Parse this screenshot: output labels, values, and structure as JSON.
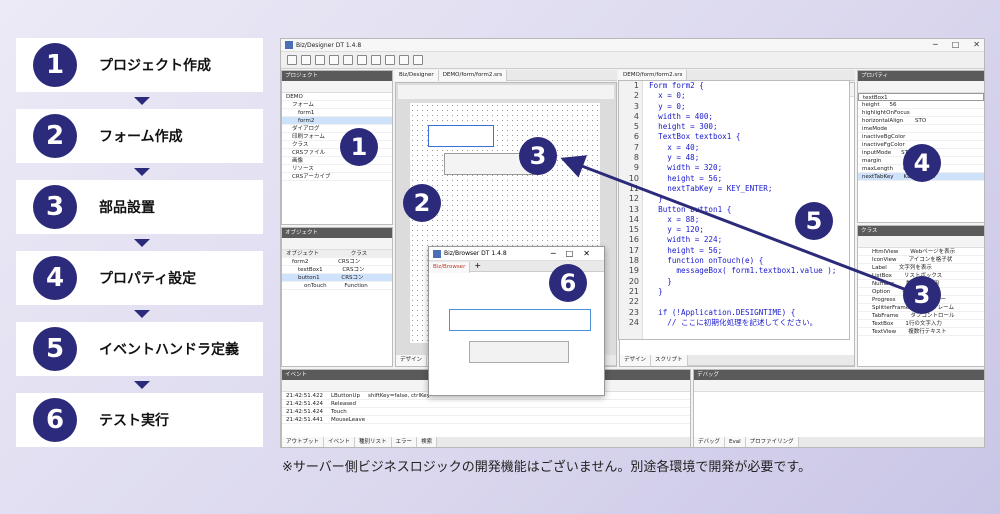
{
  "steps": [
    {
      "num": "1",
      "label": "プロジェクト作成"
    },
    {
      "num": "2",
      "label": "フォーム作成"
    },
    {
      "num": "3",
      "label": "部品設置"
    },
    {
      "num": "4",
      "label": "プロパティ設定"
    },
    {
      "num": "5",
      "label": "イベントハンドラ定義"
    },
    {
      "num": "6",
      "label": "テスト実行"
    }
  ],
  "app": {
    "title": "Biz/Designer DT 1.4.8",
    "tabs": [
      "Biz/Designer",
      "DEMO/form/form2.srs",
      "DEMO/form/form2.srs"
    ],
    "project_panel": "プロジェクト",
    "project_rows": [
      "DEMO",
      "フォーム",
      "form1",
      "form2",
      "ダイアログ",
      "印刷フォーム",
      "クラス",
      "CRSファイル",
      "画像",
      "リソース",
      "CRSアーカイブ"
    ],
    "object_panel": "オブジェクト",
    "object_cols": [
      "オブジェクト",
      "クラス"
    ],
    "object_rows": [
      [
        "form2",
        "CRSコン"
      ],
      [
        "textBox1",
        "CRSコン"
      ],
      [
        "button1",
        "CRSコン"
      ],
      [
        "onTouch",
        "Function"
      ]
    ],
    "property_panel": "プロパティ",
    "property_selected": "textBox1",
    "property_rows": [
      [
        "height",
        "56"
      ],
      [
        "highlightOnFocus",
        ""
      ],
      [
        "horizontalAlign",
        "",
        "STO"
      ],
      [
        "imeMode",
        ""
      ],
      [
        "inactiveBgColor",
        ""
      ],
      [
        "inactiveFgColor",
        ""
      ],
      [
        "inputMode",
        "STO"
      ],
      [
        "margin",
        ""
      ],
      [
        "maxLength",
        "0"
      ],
      [
        "nextTabKey",
        "KEY_ENTER"
      ]
    ],
    "class_panel": "クラス",
    "class_rows": [
      [
        "HtmlView",
        "Webページを表示"
      ],
      [
        "IconView",
        "アイコンを格子状"
      ],
      [
        "Label",
        "文字列を表示"
      ],
      [
        "ListBox",
        "リストボックス"
      ],
      [
        "Number",
        "数値入力専用"
      ],
      [
        "Option",
        "複数の選択肢"
      ],
      [
        "Progress",
        "プログレスバー"
      ],
      [
        "SplitterFrame",
        "分割フレーム"
      ],
      [
        "TabFrame",
        "タブコントロール"
      ],
      [
        "TextBox",
        "1行の文字入力"
      ],
      [
        "TextView",
        "複数行テキスト"
      ]
    ],
    "event_panel": "イベント",
    "event_rows": [
      [
        "21:42:51.422",
        "LButtonUp",
        "shiftKey=false, ctrlKey"
      ],
      [
        "21:42:51.424",
        "Released",
        ""
      ],
      [
        "21:42:51.424",
        "Touch",
        ""
      ],
      [
        "21:42:51.441",
        "MouseLeave",
        ""
      ]
    ],
    "event_tabs": [
      "アウトプット",
      "イベント",
      "種別リスト",
      "エラー",
      "検索"
    ],
    "debug_panel": "デバッグ",
    "debug_tabs": [
      "デバッグ",
      "Eval",
      "プロファイリング"
    ],
    "code_lines": [
      "Form form2 {",
      "  x = 0;",
      "  y = 0;",
      "  width = 400;",
      "  height = 300;",
      "  TextBox textbox1 {",
      "    x = 40;",
      "    y = 48;",
      "    width = 320;",
      "    height = 56;",
      "    nextTabKey = KEY_ENTER;",
      "  }",
      "  Button button1 {",
      "    x = 88;",
      "    y = 120;",
      "    width = 224;",
      "    height = 56;",
      "    function onTouch(e) {",
      "      messageBox( form1.textbox1.value );",
      "    }",
      "  }",
      "",
      "  if (!Application.DESIGNTIME) {",
      "    // ここに初期化処理を記述してください。"
    ],
    "design_tabs": [
      "デザイン",
      "スクリプト"
    ],
    "dialog_title": "Biz/Browser DT 1.4.8",
    "dialog_tab": "Biz/Browser"
  },
  "badges": [
    "1",
    "2",
    "3",
    "3",
    "4",
    "5",
    "6"
  ],
  "note": "※サーバー側ビジネスロジックの開発機能はございません。別途各環境で開発が必要です。"
}
